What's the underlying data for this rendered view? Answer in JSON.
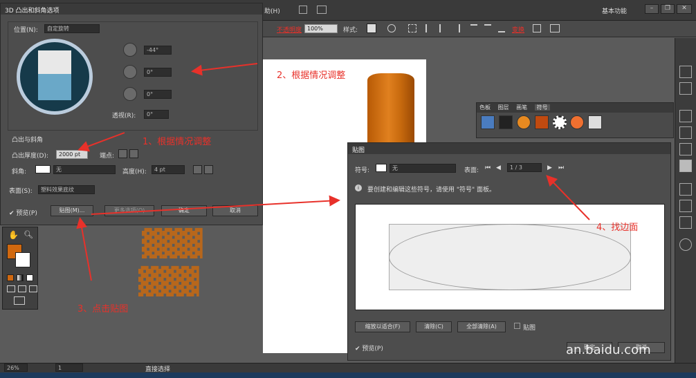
{
  "app": {
    "menu_help": "助(H)",
    "workspace": "基本功能",
    "ctrl": {
      "opacity_label": "不透明度",
      "opacity_value": "100%",
      "style_label": "样式:",
      "transform_label": "变换"
    },
    "statusbar": {
      "zoom": "26%",
      "page": "1",
      "tool": "直接选择"
    }
  },
  "dialog3d": {
    "title": "3D 凸出和斜角选项",
    "position_label": "位置(N):",
    "position_value": "自定旋转",
    "rot_x": "-44°",
    "rot_y": "0°",
    "rot_z": "0°",
    "perspective_label": "透视(R):",
    "perspective_value": "0°",
    "section_bevel": "凸出与斜角",
    "extrude_label": "凸出厚度(D):",
    "extrude_value": "2000 pt",
    "cap_label": "端点:",
    "bevel_label": "斜角:",
    "bevel_value": "无",
    "height_label": "高度(H):",
    "height_value": "4 pt",
    "surface_label": "表面(S):",
    "surface_value": "塑料效果底纹",
    "preview_label": "预览(P)",
    "map_button": "贴图(M)...",
    "more_button": "更多选项(O)",
    "ok_button": "确定",
    "cancel_button": "取消"
  },
  "dialogMap": {
    "title": "贴图",
    "symbol_label": "符号:",
    "symbol_value": "无",
    "surface_label": "表面:",
    "surface_value": "1 / 3",
    "info_text": "要创建和编辑这些符号，请使用 \"符号\" 面板。",
    "fit_button": "缩放以适合(F)",
    "clear_button": "清除(C)",
    "clear_all_button": "全部清除(A)",
    "shade_label": "贴图",
    "preview_label": "预览(P)",
    "ok_button": "确定",
    "cancel_button": "取消"
  },
  "panel_tabs": [
    "色板",
    "图层",
    "画笔",
    "符号"
  ],
  "annotations": {
    "a1": "1、根据情况调整",
    "a2": "2、根据情况调整",
    "a3": "3、点击贴图",
    "a4": "4、找边面"
  },
  "watermark": "an.baidu.com",
  "colors": {
    "accent_red": "#e8312a",
    "fill_orange": "#d0680f"
  }
}
